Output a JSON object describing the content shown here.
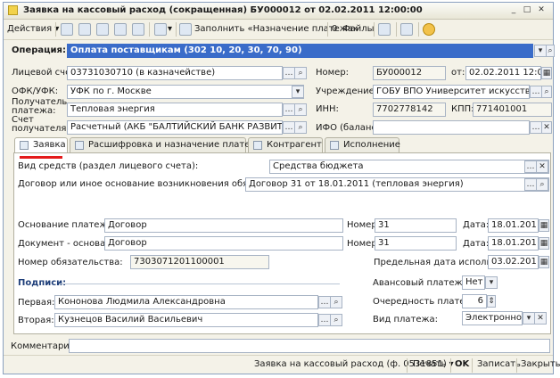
{
  "window": {
    "title": "Заявка на кассовый расход (сокращенная) БУ000012 от 02.02.2011 12:00:00"
  },
  "toolbar": {
    "actions_label": "Действия",
    "fill_label": "Заполнить «Назначение платежа»",
    "files_label": "Файлы"
  },
  "operation": {
    "label": "Операция:",
    "value": "Оплата поставщикам (302 10, 20, 30, 70, 90)"
  },
  "header": {
    "account_label": "Лицевой счет:",
    "account_value": "03731030710 (в казначействе)",
    "ofk_label": "ОФК/УФК:",
    "ofk_value": "УФК по г. Москве",
    "payee_label_1": "Получатель",
    "payee_label_2": "платежа:",
    "payee_value": "Тепловая энергия",
    "payee_acc_label_1": "Счет",
    "payee_acc_label_2": "получателя:",
    "payee_acc_value": "Расчетный (АКБ \"БАЛТИЙСКИЙ БАНК РАЗВИТИЯ\" (ЗАО)",
    "number_label": "Номер:",
    "number_value": "БУ000012",
    "from_label": "от:",
    "date_value": "02.02.2011 12:00:00",
    "org_label": "Учреждение:",
    "org_value": "ГОБУ ВПО Университет искусств (БУ бе",
    "inn_label": "ИНН:",
    "inn_value": "7702778142",
    "kpp_label": "КПП:",
    "kpp_value": "771401001",
    "ifo_label": "ИФО (баланс):",
    "ifo_value": ""
  },
  "tabs": [
    {
      "label": "Заявка"
    },
    {
      "label": "Расшифровка и назначение платежа"
    },
    {
      "label": "Контрагент"
    },
    {
      "label": "Исполнение"
    }
  ],
  "form": {
    "funds_label": "Вид средств (раздел лицевого счета):",
    "funds_value": "Средства бюджета",
    "contract_label": "Договор или иное основание возникновения обязательств:",
    "contract_value": "Договор 31 от 18.01.2011 (тепловая энергия)",
    "basis_label": "Основание платежа:",
    "basis_value": "Договор",
    "basis_num_label": "Номер:",
    "basis_num_value": "31",
    "basis_date_label": "Дата:",
    "basis_date_value": "18.01.2011",
    "doc_label": "Документ -  основание:",
    "doc_value": "Договор",
    "doc_num_label": "Номер:",
    "doc_num_value": "31",
    "doc_date_label": "Дата:",
    "doc_date_value": "18.01.2011",
    "oblig_label": "Номер обязательства:",
    "oblig_value": "7303071201100001",
    "deadline_label": "Предельная дата исполнения:",
    "deadline_value": "03.02.2011",
    "signatures_label": "Подписи:",
    "first_label": "Первая:",
    "first_value": "Кононова Людмила Александровна",
    "second_label": "Вторая:",
    "second_value": "Кузнецов Василий Васильевич",
    "advance_label": "Авансовый платеж:",
    "advance_value": "Нет",
    "priority_label": "Очередность платежа:",
    "priority_value": "6",
    "paytype_label": "Вид платежа:",
    "paytype_value": "Электронно"
  },
  "comment": {
    "label": "Комментарий:",
    "value": ""
  },
  "statusbar": {
    "form_label": "Заявка на кассовый расход (ф. 0531851)",
    "print_label": "Печать",
    "ok_label": "OK",
    "save_label": "Записать",
    "close_label": "Закрыть"
  }
}
